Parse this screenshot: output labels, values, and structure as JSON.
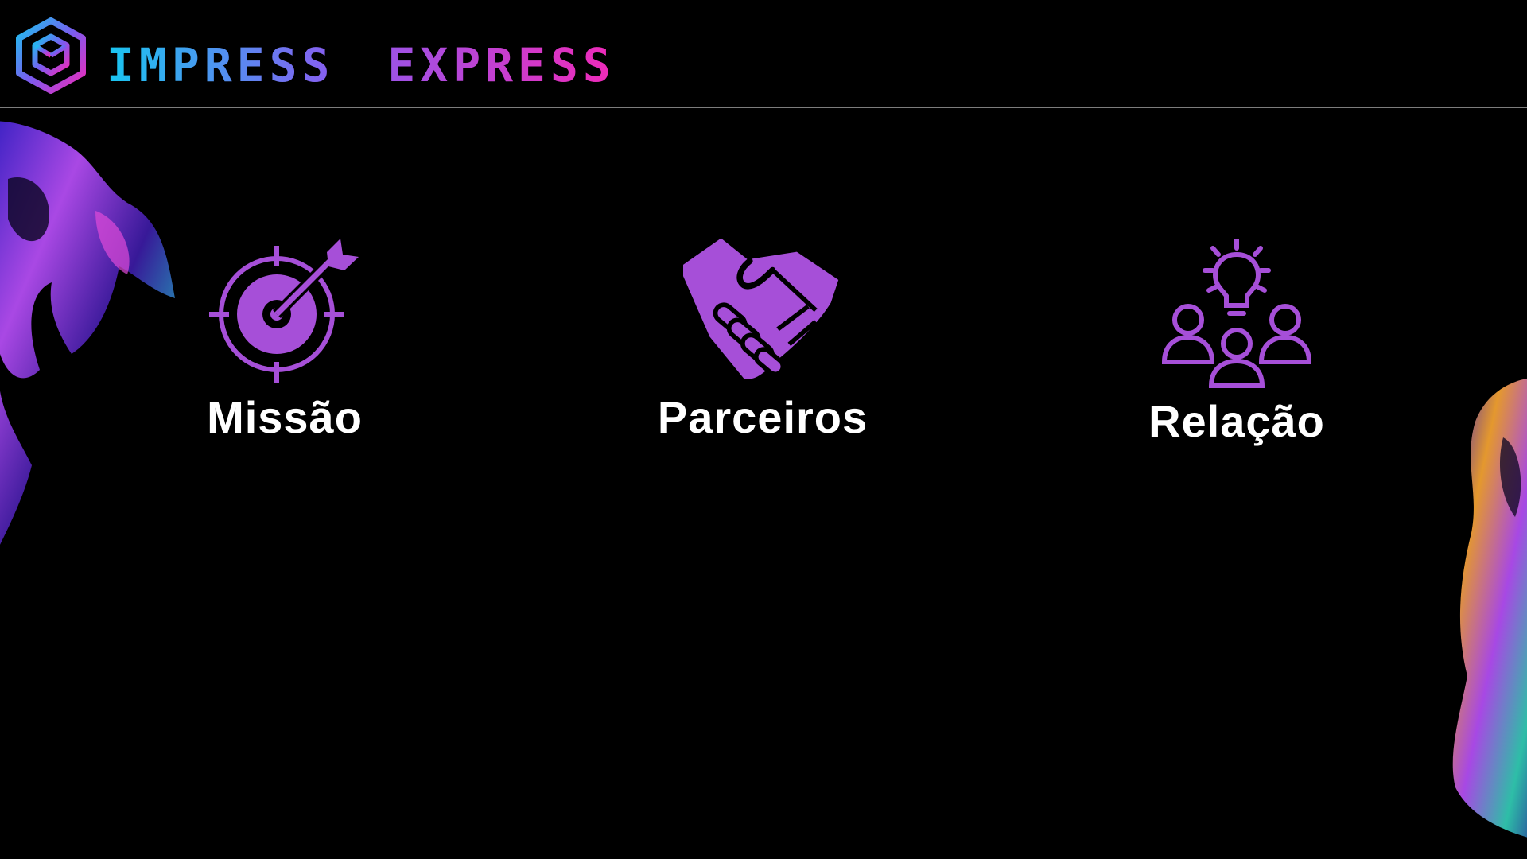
{
  "header": {
    "brand_word_1": "IMPRESS",
    "brand_word_2": "EXPRESS",
    "logo_icon": "hexagon-cube-icon"
  },
  "features": [
    {
      "label": "Missão",
      "icon": "target-arrow-icon"
    },
    {
      "label": "Parceiros",
      "icon": "handshake-icon"
    },
    {
      "label": "Relação",
      "icon": "lightbulb-team-icon"
    }
  ],
  "colors": {
    "background": "#000000",
    "icon_purple": "#a64fd8",
    "brand_cyan": "#18c6f0",
    "brand_violet": "#8a5cf0",
    "brand_magenta": "#f02ab8",
    "label_white": "#ffffff"
  }
}
